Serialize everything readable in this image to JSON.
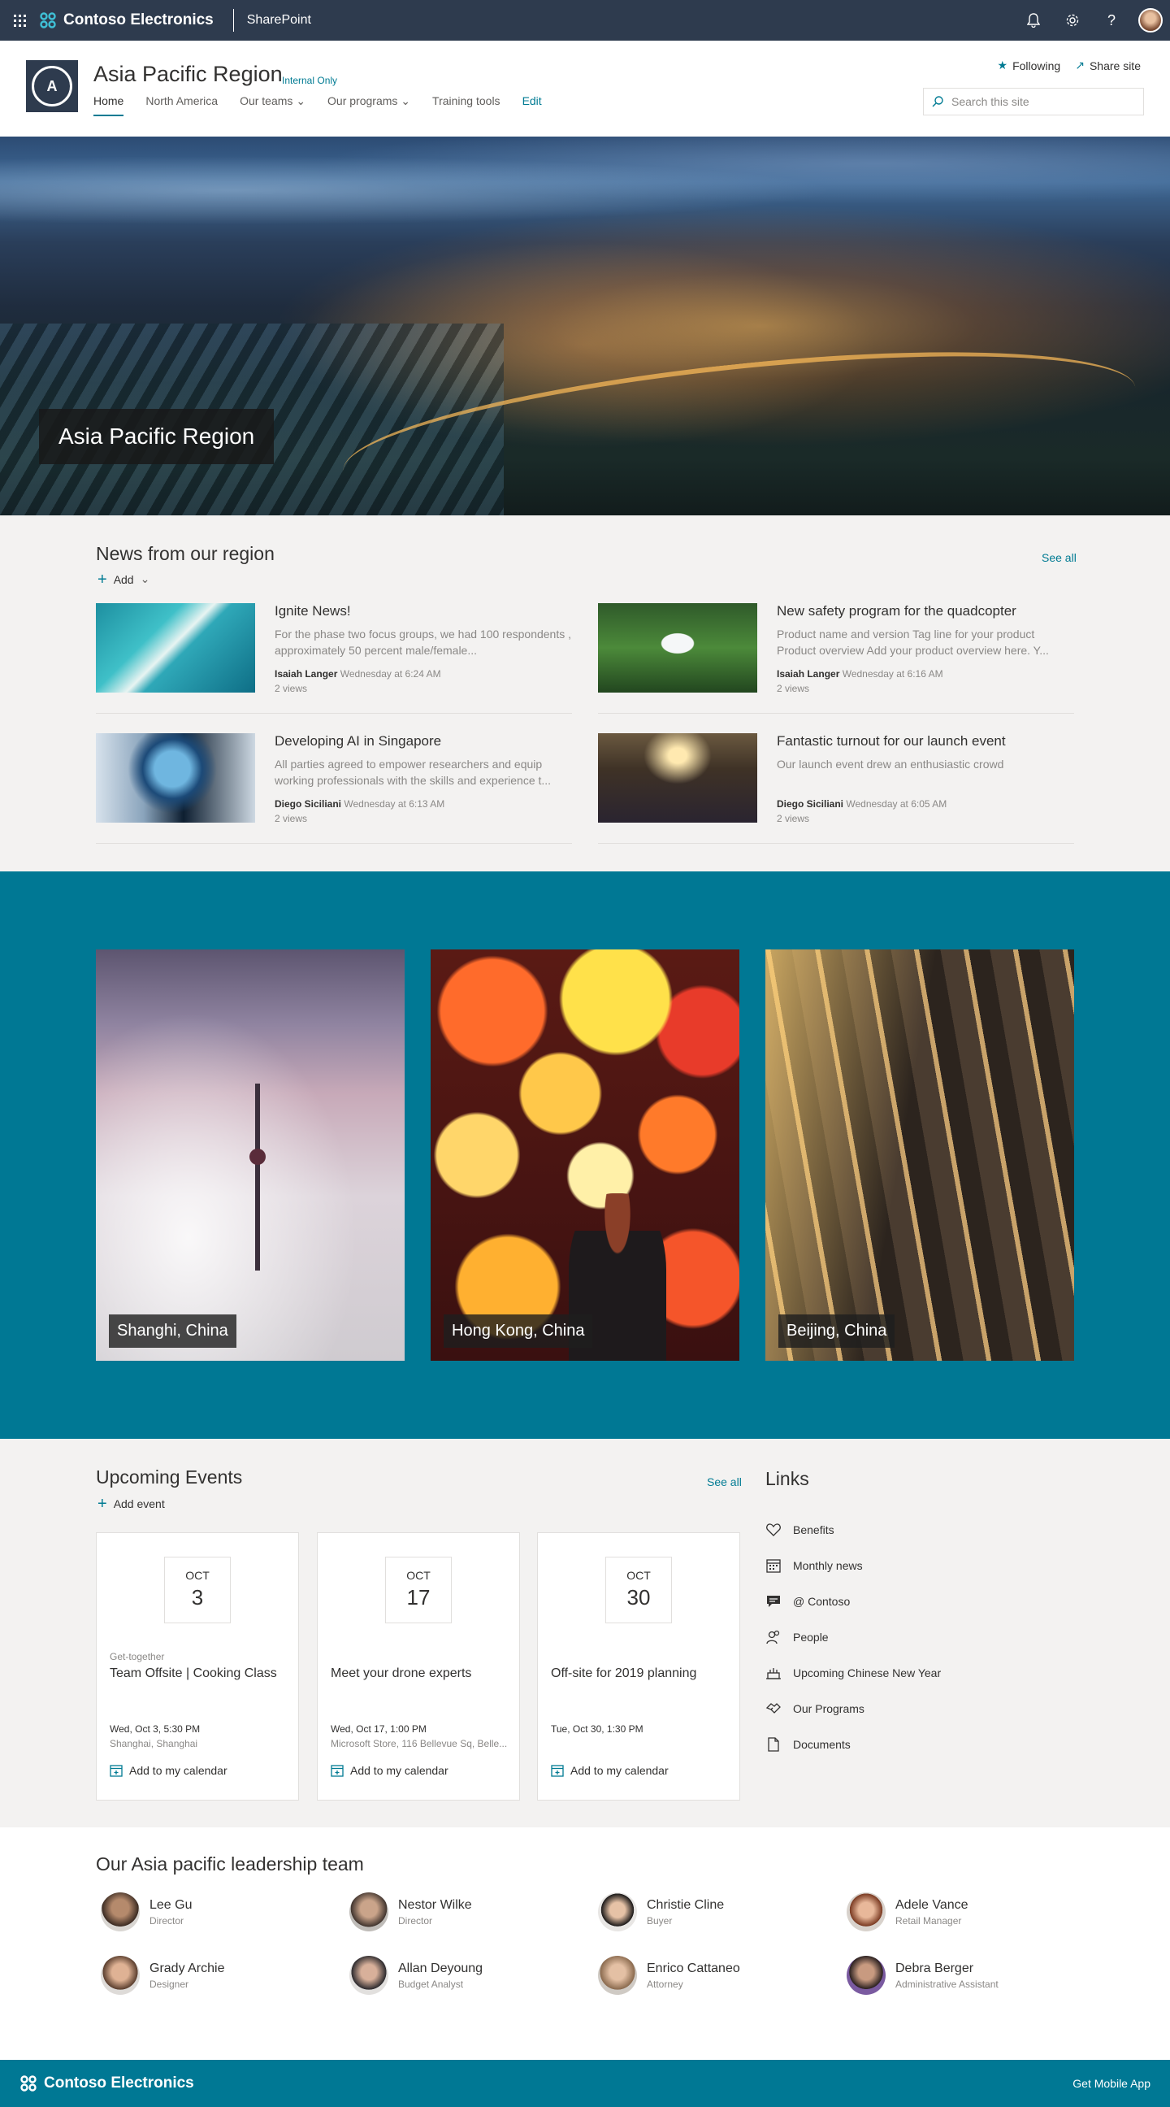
{
  "suite": {
    "brand": "Contoso Electronics",
    "app": "SharePoint"
  },
  "site": {
    "title": "Asia Pacific Region",
    "badge": "Internal Only",
    "logo_letter": "A",
    "nav": [
      "Home",
      "North America",
      "Our teams",
      "Our programs",
      "Training tools"
    ],
    "edit": "Edit",
    "following": "Following",
    "share": "Share site",
    "search_placeholder": "Search this site"
  },
  "hero": {
    "label": "Asia Pacific Region"
  },
  "news": {
    "title": "News from our region",
    "see_all": "See all",
    "add": "Add",
    "items": [
      {
        "title": "Ignite News!",
        "desc": "For the phase two focus groups, we had 100 respondents , approximately 50 percent male/female...",
        "author": "Isaiah Langer",
        "time": "Wednesday at 6:24 AM",
        "views": "2 views"
      },
      {
        "title": "New safety program for the quadcopter",
        "desc": "Product name and version Tag line for your product Product overview Add your product overview here. Y...",
        "author": "Isaiah Langer",
        "time": "Wednesday at 6:16 AM",
        "views": "2 views"
      },
      {
        "title": "Developing AI in Singapore",
        "desc": "All parties agreed to empower researchers and equip working professionals with the skills and experience t...",
        "author": "Diego Siciliani",
        "time": "Wednesday at 6:13 AM",
        "views": "2 views"
      },
      {
        "title": "Fantastic turnout for our launch event",
        "desc": "Our launch event drew an enthusiastic crowd",
        "author": "Diego Siciliani",
        "time": "Wednesday at 6:05 AM",
        "views": "2 views"
      }
    ]
  },
  "cities": [
    "Shanghi, China",
    "Hong Kong, China",
    "Beijing, China"
  ],
  "events": {
    "title": "Upcoming Events",
    "see_all": "See all",
    "add": "Add event",
    "cal_label": "Add to my calendar",
    "items": [
      {
        "month": "OCT",
        "day": "3",
        "category": "Get-together",
        "title": "Team Offsite | Cooking Class",
        "date": "Wed, Oct 3, 5:30 PM",
        "location": "Shanghai, Shanghai"
      },
      {
        "month": "OCT",
        "day": "17",
        "category": "",
        "title": "Meet your drone experts",
        "date": "Wed, Oct 17, 1:00 PM",
        "location": "Microsoft Store, 116 Bellevue Sq, Belle..."
      },
      {
        "month": "OCT",
        "day": "30",
        "category": "",
        "title": "Off-site for 2019 planning",
        "date": "Tue, Oct 30, 1:30 PM",
        "location": ""
      }
    ]
  },
  "links": {
    "title": "Links",
    "items": [
      "Benefits",
      "Monthly news",
      "@ Contoso",
      "People",
      "Upcoming Chinese New Year",
      "Our Programs",
      "Documents"
    ]
  },
  "leaders": {
    "title": "Our Asia pacific leadership team",
    "people": [
      {
        "name": "Lee Gu",
        "role": "Director"
      },
      {
        "name": "Nestor Wilke",
        "role": "Director"
      },
      {
        "name": "Christie Cline",
        "role": "Buyer"
      },
      {
        "name": "Adele Vance",
        "role": "Retail Manager"
      },
      {
        "name": "Grady Archie",
        "role": "Designer"
      },
      {
        "name": "Allan Deyoung",
        "role": "Budget Analyst"
      },
      {
        "name": "Enrico Cattaneo",
        "role": "Attorney"
      },
      {
        "name": "Debra Berger",
        "role": "Administrative Assistant"
      }
    ]
  },
  "footer": {
    "brand": "Contoso Electronics",
    "mobile": "Get Mobile App"
  },
  "colors": {
    "suite_bar": "#2e3b4e",
    "accent": "#007b93",
    "band": "#007894"
  }
}
